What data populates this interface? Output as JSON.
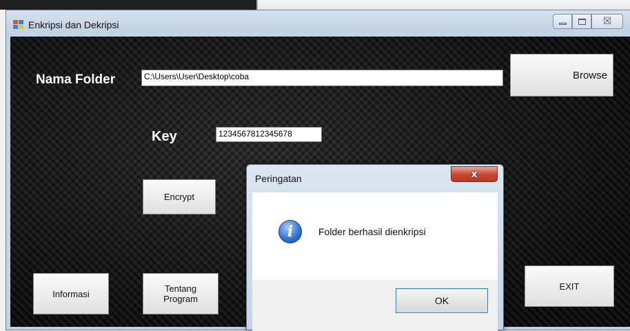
{
  "window": {
    "title": "Enkripsi dan Dekripsi",
    "min_glyph": "minimize",
    "max_glyph": "maximize",
    "close_glyph": "☒"
  },
  "form": {
    "folder_label": "Nama Folder",
    "folder_value": "C:\\Users\\User\\Desktop\\coba",
    "browse_label": "Browse",
    "key_label": "Key",
    "key_value": "1234567812345678",
    "encrypt_label": "Encrypt",
    "info_label": "Informasi",
    "about_label_line1": "Tentang",
    "about_label_line2": "Program",
    "exit_label": "EXIT"
  },
  "dialog": {
    "title": "Peringatan",
    "close_glyph": "x",
    "message": "Folder berhasil dienkripsi",
    "icon": "info-icon",
    "ok_label": "OK"
  }
}
